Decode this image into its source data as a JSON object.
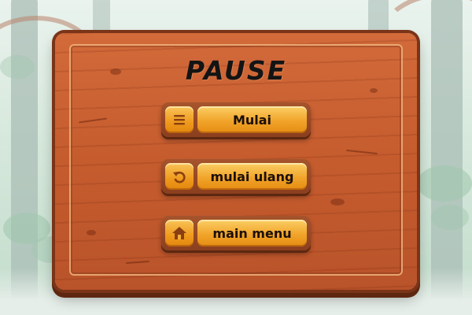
{
  "title": "PAUSE",
  "buttons": [
    {
      "label": "Mulai",
      "icon": "menu-lines-icon"
    },
    {
      "label": "mulai ulang",
      "icon": "restart-arrow-icon"
    },
    {
      "label": "main menu",
      "icon": "home-icon"
    }
  ],
  "colors": {
    "panel_wood": "#c55c2e",
    "panel_border": "#7a3418",
    "button_fill": "#f1a42a",
    "title_text": "#141414"
  }
}
